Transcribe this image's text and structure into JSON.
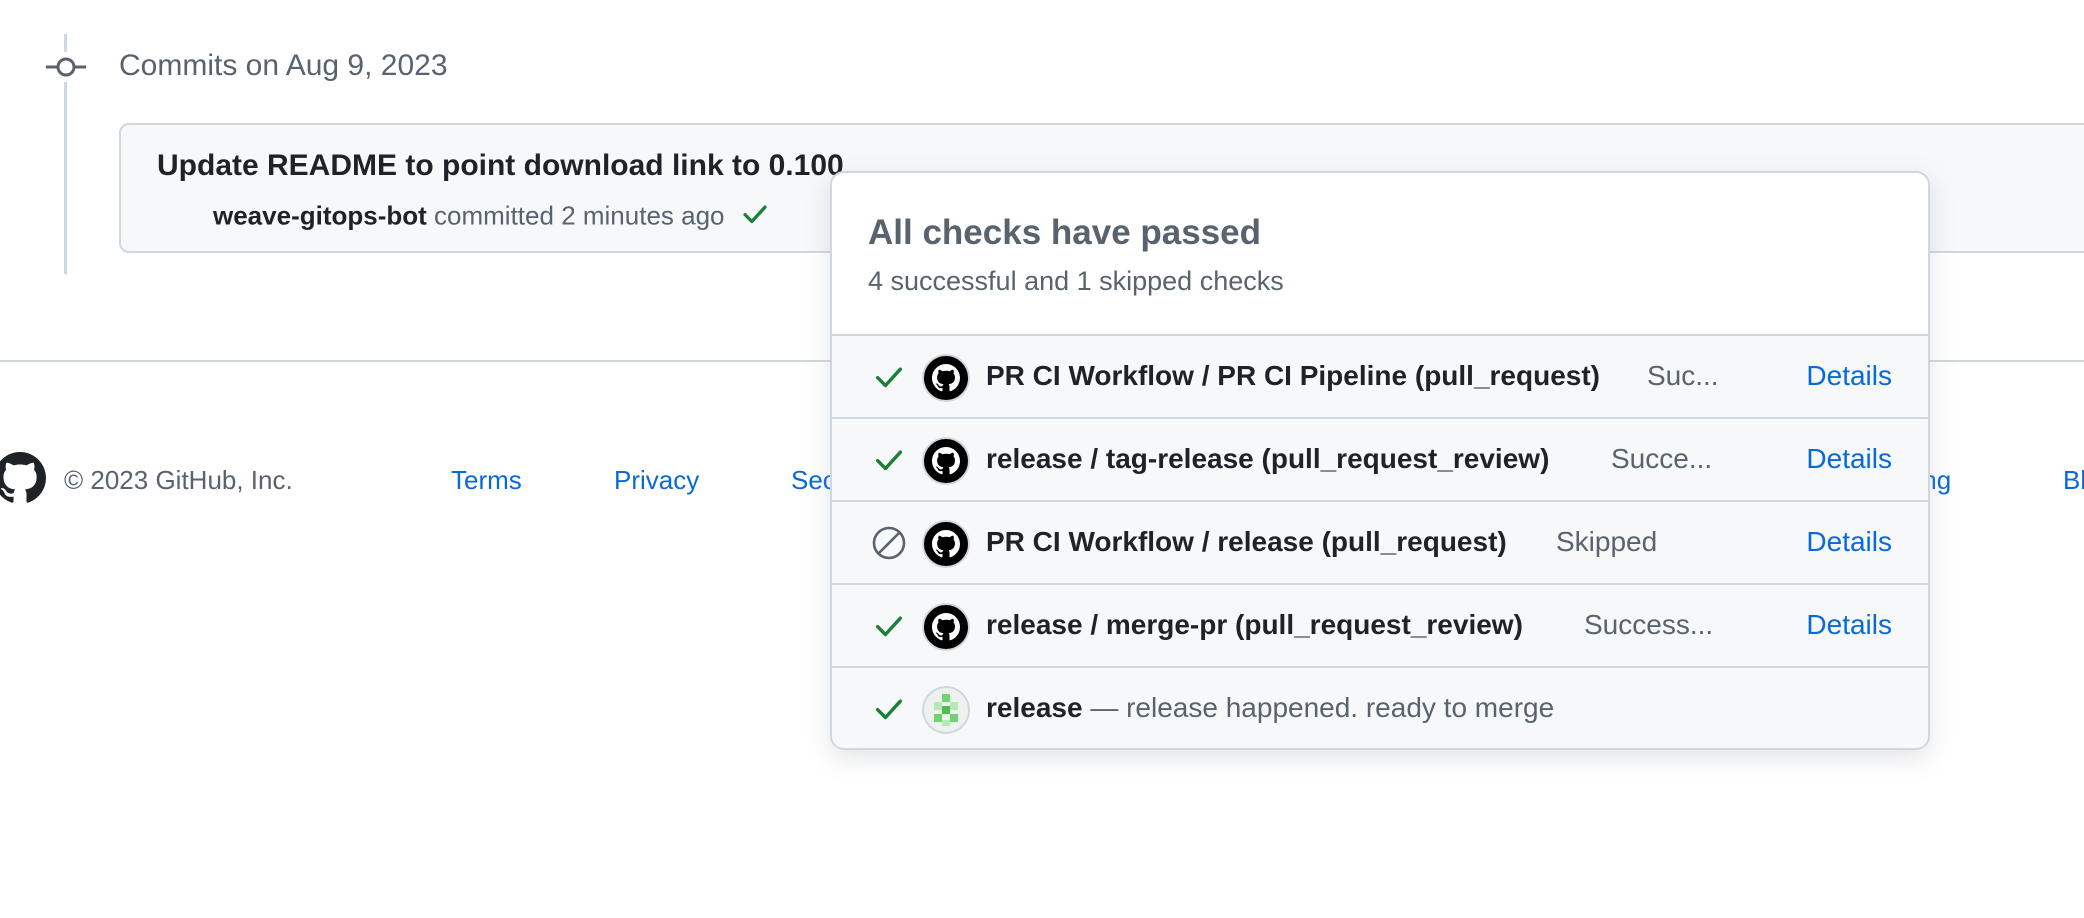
{
  "timeline": {
    "heading": "Commits on Aug 9, 2023"
  },
  "commit": {
    "title": "Update README to point download link to 0.100",
    "author": "weave-gitops-bot",
    "action": "committed",
    "time": "2 minutes ago",
    "status_icon": "check-icon"
  },
  "footer": {
    "logo_icon": "github-mark-icon",
    "copyright": "© 2023 GitHub, Inc.",
    "links": [
      "Terms",
      "Privacy",
      "Sec",
      "ning",
      "Bl"
    ]
  },
  "checks_popover": {
    "title": "All checks have passed",
    "subtitle": "4 successful and 1 skipped checks",
    "rows": [
      {
        "status": "success",
        "name": "PR CI Workflow / PR CI Pipeline (pull_request)",
        "state": "Suc...",
        "details": "Details",
        "avatar": "github-actions-avatar"
      },
      {
        "status": "success",
        "name": "release / tag-release (pull_request_review)",
        "state": "Succe...",
        "details": "Details",
        "avatar": "github-actions-avatar"
      },
      {
        "status": "skipped",
        "name": "PR CI Workflow / release (pull_request)",
        "state": "Skipped",
        "details": "Details",
        "avatar": "github-actions-avatar"
      },
      {
        "status": "success",
        "name": "release / merge-pr (pull_request_review)",
        "state": "Success...",
        "details": "Details",
        "avatar": "github-actions-avatar"
      },
      {
        "status": "success",
        "name": "release",
        "description": "— release happened. ready to merge",
        "avatar": "release-app-avatar"
      }
    ]
  },
  "colors": {
    "success": "#1a7f37",
    "link": "#0969da",
    "muted": "#59636e",
    "border": "#d0d7de",
    "row_bg": "#f6f8fa"
  }
}
